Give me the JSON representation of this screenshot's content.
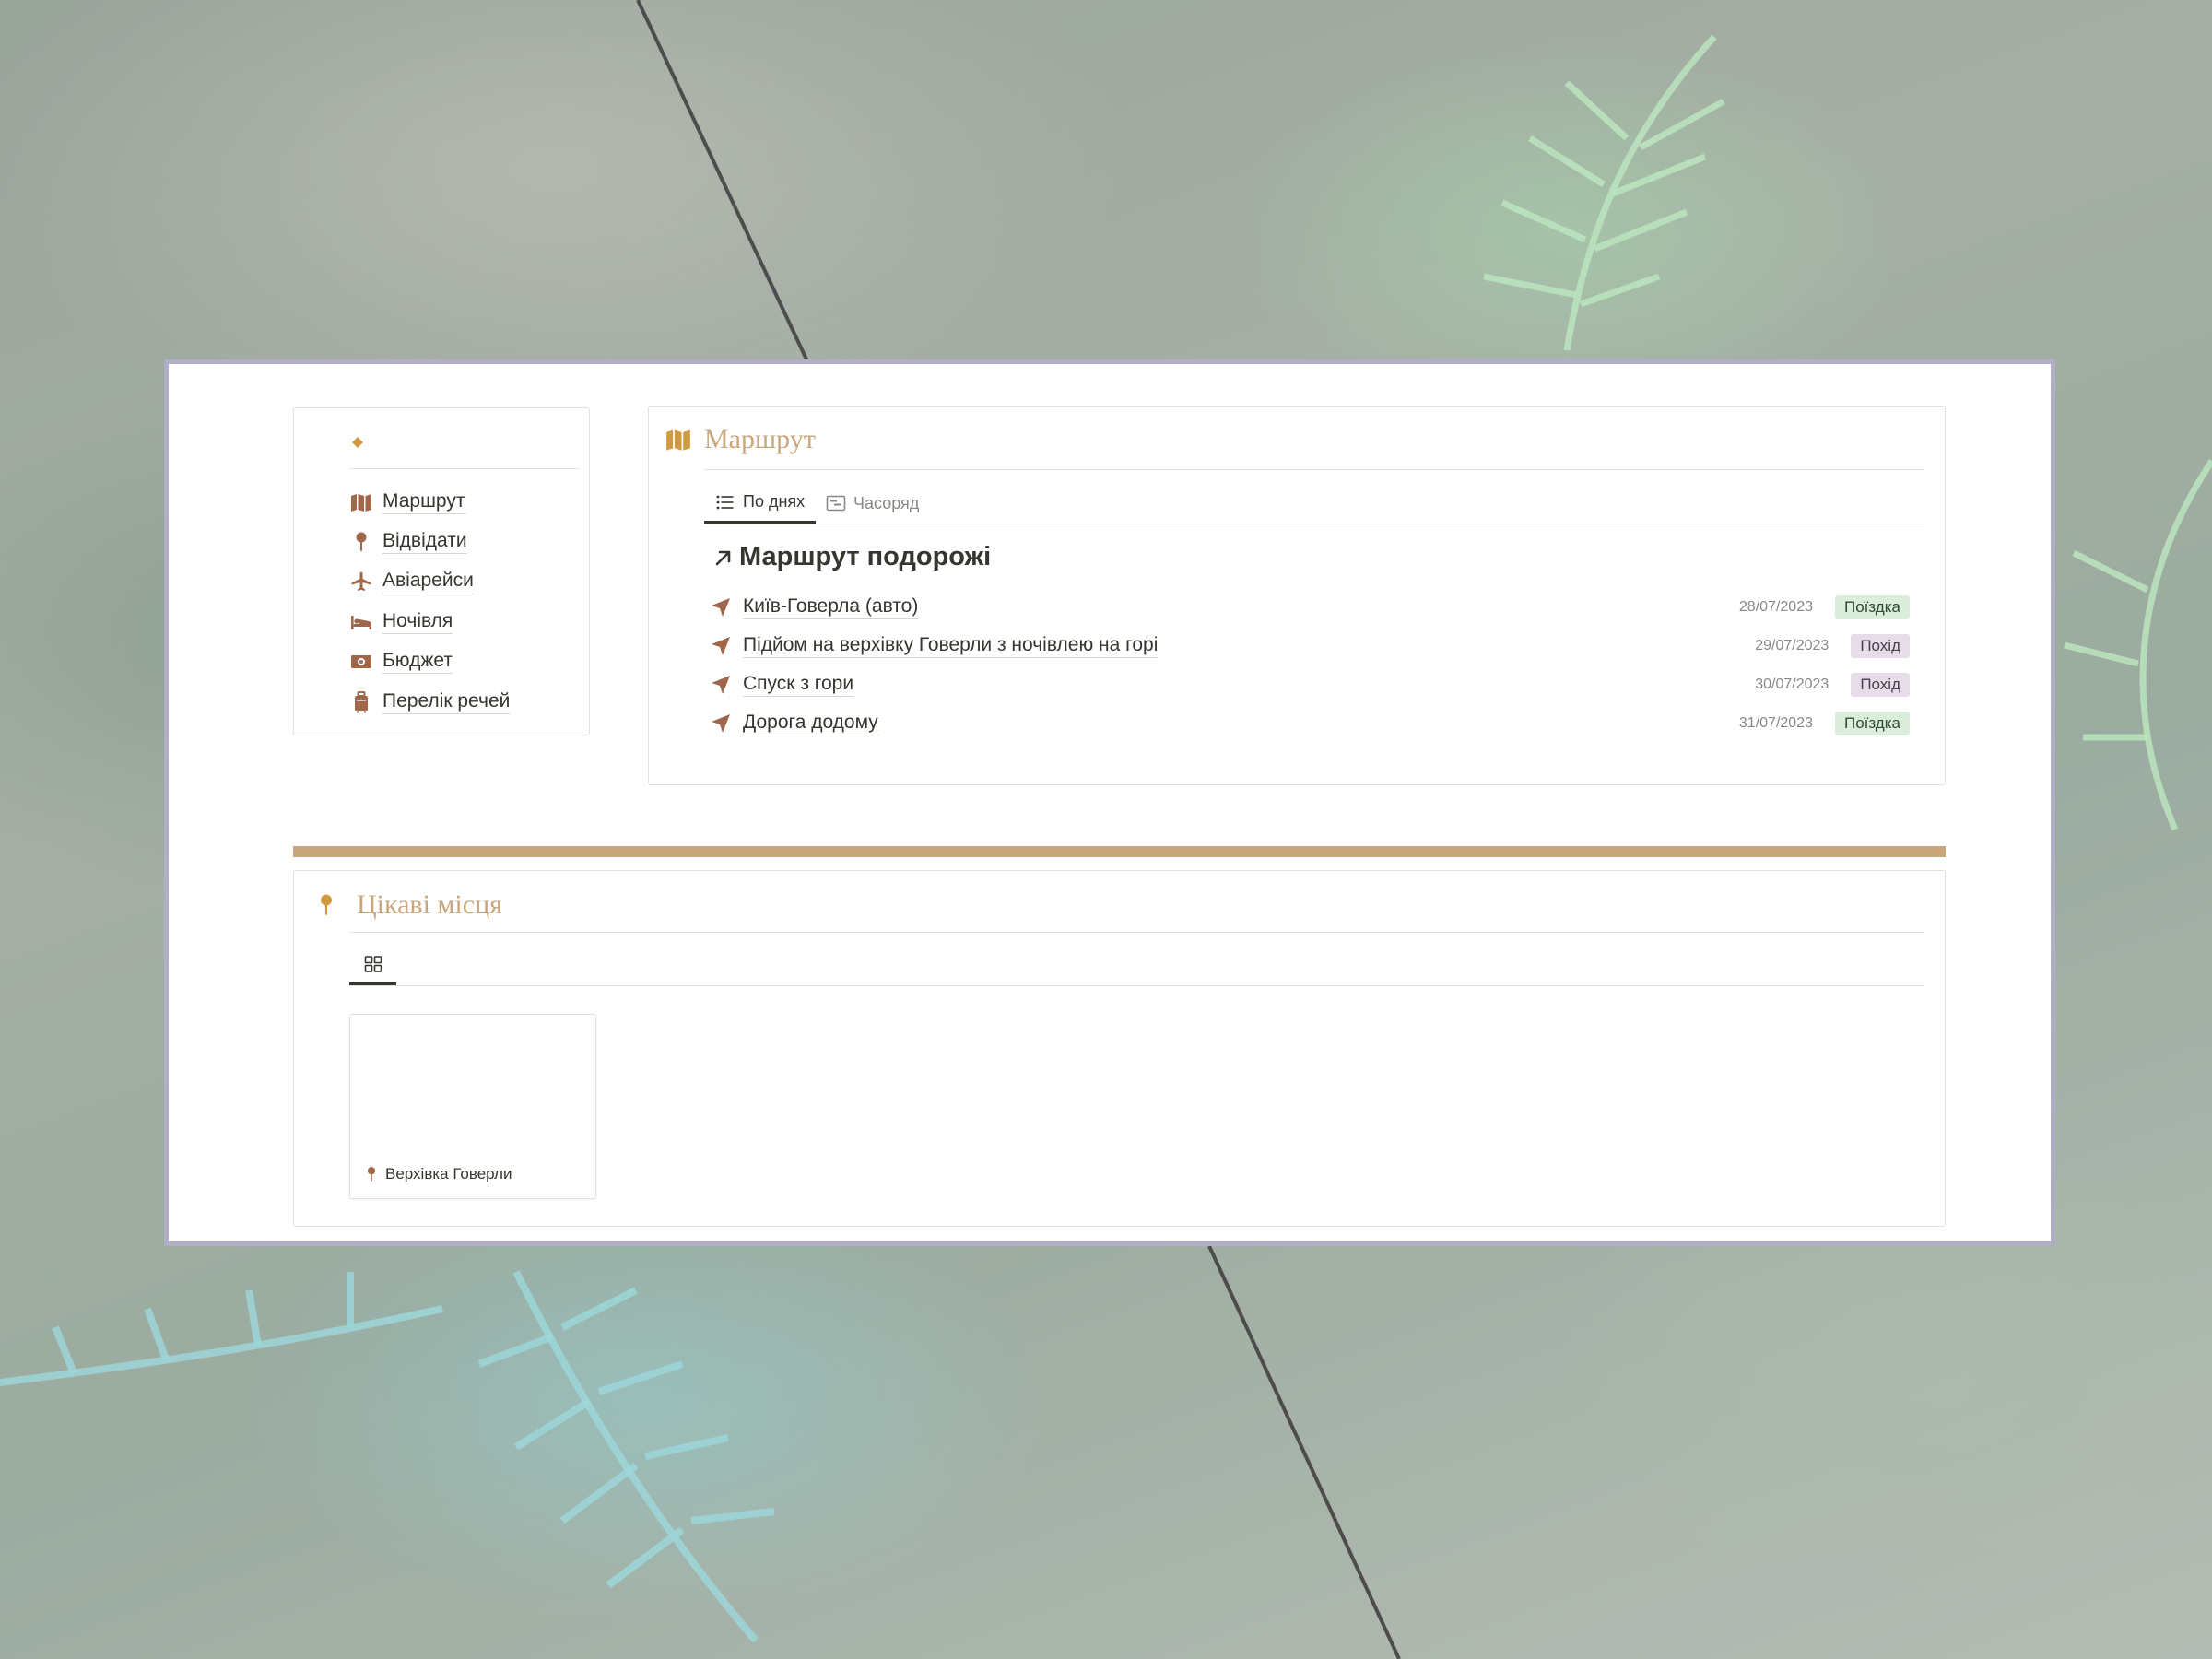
{
  "colors": {
    "accent": "#c9a77c",
    "icon_brown": "#a0674b",
    "icon_gold": "#d19a3f",
    "frame": "#b3aec8",
    "tag_trip_bg": "#dbeddb",
    "tag_hike_bg": "#e6dde9"
  },
  "nav": {
    "items": [
      {
        "label": "Маршрут",
        "icon": "map-icon"
      },
      {
        "label": "Відвідати",
        "icon": "pin-icon"
      },
      {
        "label": "Авіарейси",
        "icon": "airplane-icon"
      },
      {
        "label": "Ночівля",
        "icon": "bed-icon"
      },
      {
        "label": "Бюджет",
        "icon": "money-icon"
      },
      {
        "label": "Перелік речей",
        "icon": "luggage-icon"
      }
    ]
  },
  "route": {
    "title": "Маршрут",
    "tabs": [
      {
        "label": "По днях",
        "icon": "list-icon",
        "active": true
      },
      {
        "label": "Часоряд",
        "icon": "timeline-icon",
        "active": false
      }
    ],
    "group_title": "Маршрут подорожі",
    "rows": [
      {
        "name": "Київ-Говерла (авто)",
        "date": "28/07/2023",
        "tag": "Поїздка"
      },
      {
        "name": "Підйом на верхівку Говерли з ночівлею на горі",
        "date": "29/07/2023",
        "tag": "Похід"
      },
      {
        "name": "Спуск з гори",
        "date": "30/07/2023",
        "tag": "Похід"
      },
      {
        "name": "Дорога додому",
        "date": "31/07/2023",
        "tag": "Поїздка"
      }
    ]
  },
  "places": {
    "title": "Цікаві місця",
    "view_icon": "gallery-icon",
    "cards": [
      {
        "name": "Верхівка Говерли",
        "icon": "pin-icon"
      }
    ]
  }
}
